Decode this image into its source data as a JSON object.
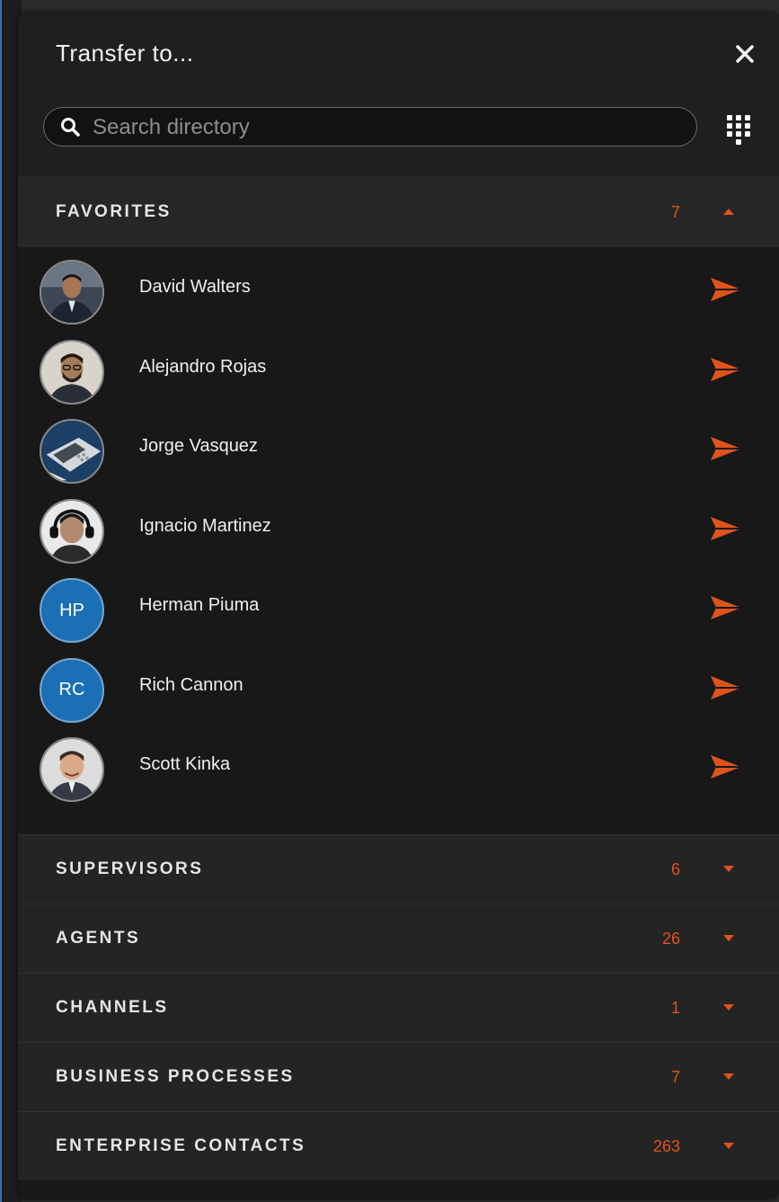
{
  "dialog": {
    "title": "Transfer to...",
    "close_icon": "close-icon"
  },
  "search": {
    "placeholder": "Search directory",
    "value": "",
    "icon": "search-icon",
    "dialpad_icon": "dialpad-icon"
  },
  "colors": {
    "accent": "#e0531c",
    "initials_avatar": "#1a6fb5",
    "panel_bg": "#181818"
  },
  "sections": {
    "favorites": {
      "title": "FAVORITES",
      "count": "7",
      "expanded": true
    },
    "supervisors": {
      "title": "SUPERVISORS",
      "count": "6",
      "expanded": false
    },
    "agents": {
      "title": "AGENTS",
      "count": "26",
      "expanded": false
    },
    "channels": {
      "title": "CHANNELS",
      "count": "1",
      "expanded": false
    },
    "business_processes": {
      "title": "BUSINESS PROCESSES",
      "count": "7",
      "expanded": false
    },
    "enterprise_contacts": {
      "title": "ENTERPRISE CONTACTS",
      "count": "263",
      "expanded": false
    }
  },
  "favorites": [
    {
      "name": "David Walters",
      "avatar": "photo"
    },
    {
      "name": "Alejandro Rojas",
      "avatar": "photo"
    },
    {
      "name": "Jorge Vasquez",
      "avatar": "photo-phone"
    },
    {
      "name": "Ignacio Martinez",
      "avatar": "photo"
    },
    {
      "name": "Herman Piuma",
      "avatar": "initials",
      "initials": "HP"
    },
    {
      "name": "Rich Cannon",
      "avatar": "initials",
      "initials": "RC"
    },
    {
      "name": "Scott Kinka",
      "avatar": "photo"
    }
  ]
}
